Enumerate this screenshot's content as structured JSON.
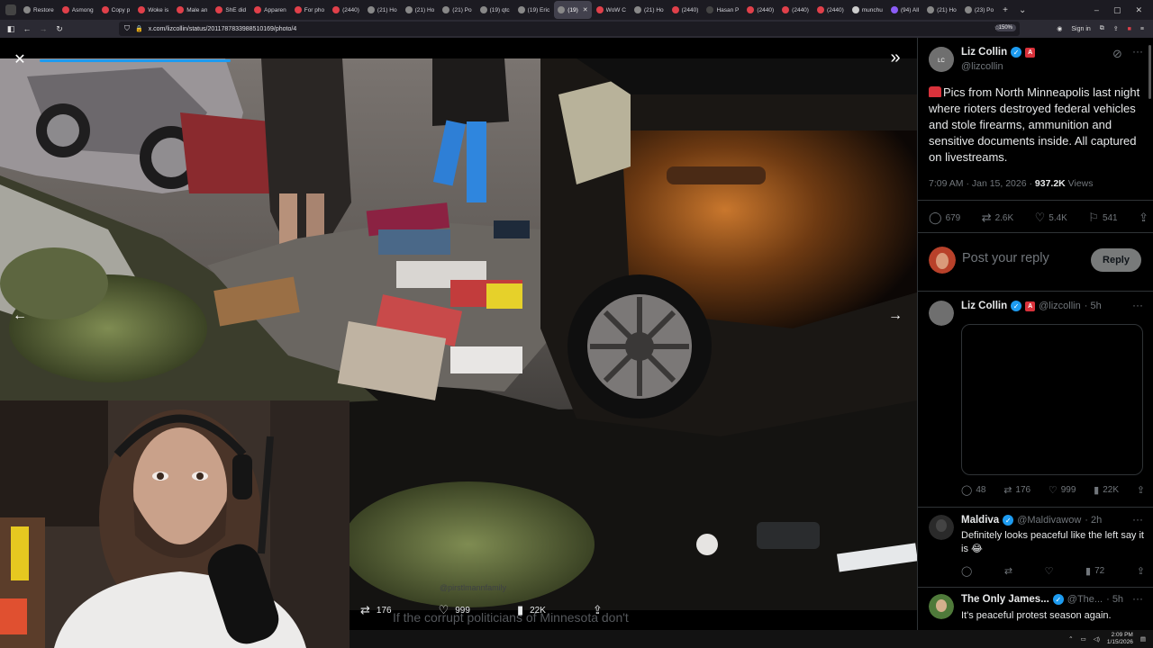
{
  "browser": {
    "tabs": [
      {
        "label": "Restore",
        "fav": "#888"
      },
      {
        "label": "Asmong",
        "fav": "#e0404a"
      },
      {
        "label": "Copy p",
        "fav": "#e0404a"
      },
      {
        "label": "Woke is",
        "fav": "#e0404a"
      },
      {
        "label": "Male an",
        "fav": "#e0404a"
      },
      {
        "label": "ShE did",
        "fav": "#e0404a"
      },
      {
        "label": "Apparen",
        "fav": "#e0404a"
      },
      {
        "label": "For pho",
        "fav": "#e0404a"
      },
      {
        "label": "(2440)",
        "fav": "#e0404a"
      },
      {
        "label": "(21) Ho",
        "fav": "#888"
      },
      {
        "label": "(21) Ho",
        "fav": "#888"
      },
      {
        "label": "(21) Po",
        "fav": "#888"
      },
      {
        "label": "(19) qtc",
        "fav": "#888"
      },
      {
        "label": "(19) Eric",
        "fav": "#888"
      },
      {
        "label": "(19)",
        "fav": "#888",
        "active": true
      },
      {
        "label": "WoW C",
        "fav": "#e0404a"
      },
      {
        "label": "(21) Ho",
        "fav": "#888"
      },
      {
        "label": "(2440)",
        "fav": "#e0404a"
      },
      {
        "label": "Hasan P",
        "fav": "#444"
      },
      {
        "label": "(2440)",
        "fav": "#e0404a"
      },
      {
        "label": "(2440)",
        "fav": "#e0404a"
      },
      {
        "label": "(2440)",
        "fav": "#e0404a"
      },
      {
        "label": "munchu",
        "fav": "#ccc"
      },
      {
        "label": "(94) All",
        "fav": "#8b5cf6"
      },
      {
        "label": "(21) Ho",
        "fav": "#888"
      },
      {
        "label": "(23) Po",
        "fav": "#888"
      }
    ],
    "url": "x.com/lizcollin/status/2011787833988510169/photo/4",
    "zoom": "150%",
    "sign_in": "Sign in"
  },
  "media": {
    "actions": {
      "retweets": "176",
      "likes": "999",
      "views": "22K"
    },
    "behind_text": "If the corrupt politicians of Minnesota don't",
    "behind_handle": "@pirstlmannfamily"
  },
  "post": {
    "author_name": "Liz Collin",
    "author_handle": "@lizcollin",
    "text": "Pics from North Minneapolis last night where rioters destroyed federal vehicles and stole firearms, ammunition and sensitive documents inside. All captured on livestreams.",
    "time": "7:09 AM · Jan 15, 2026 · ",
    "views_count": "937.2K",
    "views_label": " Views",
    "replies": "679",
    "reposts": "2.6K",
    "likes": "5.4K",
    "bookmarks": "541",
    "reply_placeholder": "Post your reply",
    "reply_button": "Reply"
  },
  "replies": [
    {
      "name": "Liz Collin",
      "handle": "@lizcollin",
      "age": "· 5h",
      "replies": "48",
      "reposts": "176",
      "likes": "999",
      "views": "22K"
    },
    {
      "name": "Maldiva",
      "handle": "@Maldivawow",
      "age": "· 2h",
      "text": "Definitely looks peaceful like the left say it is 😂",
      "views": "72"
    },
    {
      "name": "The Only James...",
      "handle": "@The...",
      "age": "· 5h",
      "text": "It's peaceful protest season again."
    }
  ],
  "taskbar": {
    "time": "2:09 PM",
    "date": "1/15/2026"
  },
  "colors": {
    "accent": "#1d9bf0",
    "affiliate": "#d9323b",
    "background": "#000000",
    "muted": "#71767b"
  }
}
